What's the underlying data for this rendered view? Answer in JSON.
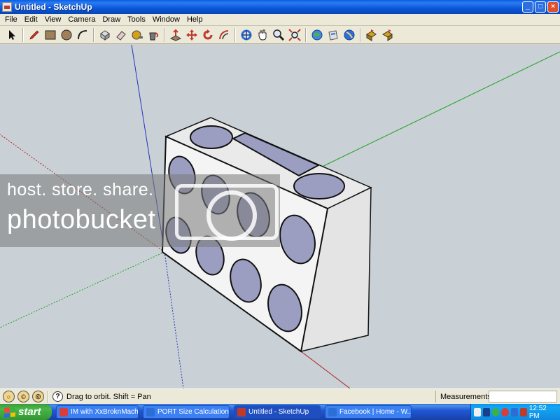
{
  "window": {
    "title": "Untitled - SketchUp",
    "minimize": "_",
    "maximize": "□",
    "close": "×"
  },
  "menu": [
    "File",
    "Edit",
    "View",
    "Camera",
    "Draw",
    "Tools",
    "Window",
    "Help"
  ],
  "toolbar": {
    "icons": [
      "select-icon",
      "pencil-icon",
      "rectangle-icon",
      "circle-icon",
      "arc-icon",
      "make-component-icon",
      "eraser-icon",
      "tape-measure-icon",
      "paint-bucket-icon",
      "push-pull-icon",
      "move-icon",
      "rotate-icon",
      "offset-icon",
      "orbit-icon",
      "pan-icon",
      "zoom-icon",
      "zoom-extents-icon",
      "get-models-icon",
      "share-model-icon",
      "google-earth-icon",
      "previous-view-icon",
      "next-view-icon"
    ]
  },
  "watermark": {
    "line1": "host. store. share.",
    "line2": "photobucket"
  },
  "status": {
    "hint": "Drag to orbit.  Shift = Pan",
    "measurements_label": "Measurements",
    "measurements_value": ""
  },
  "taskbar": {
    "start": "start",
    "tasks": [
      {
        "label": "IM with XxBroknMachi...",
        "icon_color": "#d63d3d",
        "active": false
      },
      {
        "label": "PORT Size Calculation...",
        "icon_color": "#2b6fd6",
        "active": false
      },
      {
        "label": "Untitled - SketchUp",
        "icon_color": "#c0392b",
        "active": true
      },
      {
        "label": "Facebook | Home - W...",
        "icon_color": "#2b6fd6",
        "active": false
      }
    ],
    "clock": "12:52 PM"
  },
  "colors": {
    "viewport_bg": "#c9d1d6",
    "port_fill": "#9b9ec0",
    "box_face": "#f2f2f2",
    "axis_green": "#1ea01e",
    "axis_blue": "#2233bb",
    "axis_red": "#b02020"
  }
}
